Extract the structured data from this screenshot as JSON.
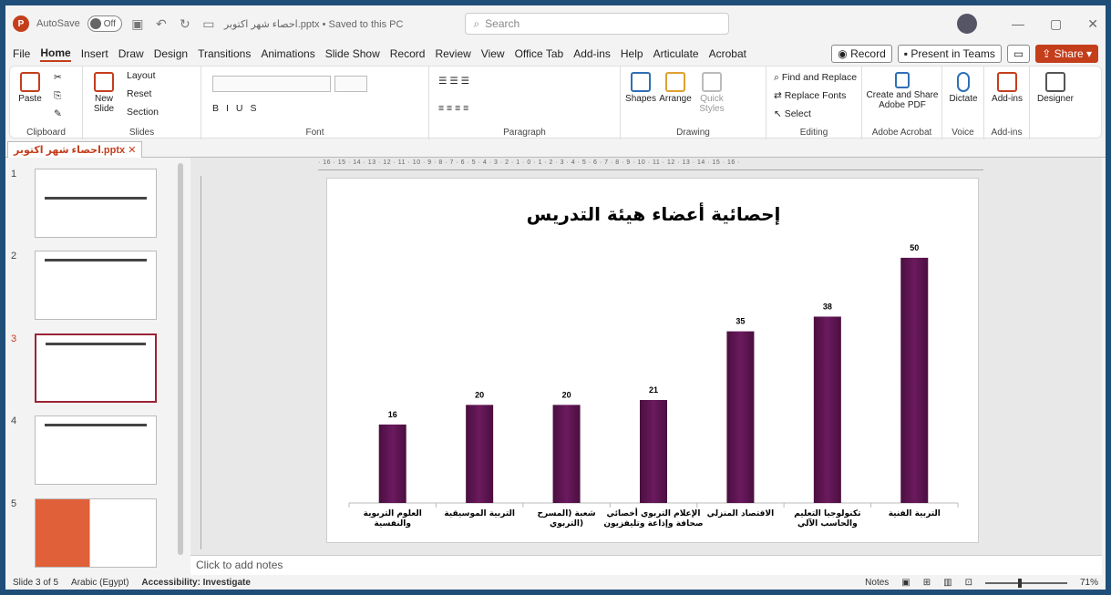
{
  "window": {
    "autosave_label": "AutoSave",
    "autosave_state": "Off",
    "doc_title": "احصاء شهر اكتوبر.pptx • Saved to this PC",
    "search_placeholder": "Search"
  },
  "menu": {
    "items": [
      "File",
      "Home",
      "Insert",
      "Draw",
      "Design",
      "Transitions",
      "Animations",
      "Slide Show",
      "Record",
      "Review",
      "View",
      "Office Tab",
      "Add-ins",
      "Help",
      "Articulate",
      "Acrobat"
    ],
    "record_btn": "Record",
    "present_btn": "Present in Teams",
    "share_btn": "Share"
  },
  "ribbon": {
    "clipboard": {
      "paste": "Paste",
      "label": "Clipboard"
    },
    "slides": {
      "new_slide": "New Slide",
      "layout": "Layout",
      "reset": "Reset",
      "section": "Section",
      "label": "Slides"
    },
    "font": {
      "label": "Font"
    },
    "paragraph": {
      "label": "Paragraph"
    },
    "drawing": {
      "shapes": "Shapes",
      "arrange": "Arrange",
      "quick_styles": "Quick Styles",
      "label": "Drawing"
    },
    "editing": {
      "find_replace": "Find and Replace",
      "replace_fonts": "Replace Fonts",
      "select": "Select",
      "label": "Editing"
    },
    "acrobat": {
      "create_share": "Create and Share Adobe PDF",
      "label": "Adobe Acrobat"
    },
    "voice": {
      "dictate": "Dictate",
      "label": "Voice"
    },
    "addins": {
      "addins": "Add-ins",
      "label": "Add-ins"
    },
    "designer": {
      "designer": "Designer"
    }
  },
  "tabs": {
    "doc_tab": "احصاء شهر اكتوبر.pptx"
  },
  "slides_panel": {
    "items": [
      {
        "num": "1"
      },
      {
        "num": "2"
      },
      {
        "num": "3"
      },
      {
        "num": "4"
      },
      {
        "num": "5"
      }
    ]
  },
  "ruler": {
    "h": "· 16 · 15 · 14 · 13 · 12 · 11 · 10 · 9 · 8 · 7 · 6 · 5 · 4 · 3 · 2 · 1 · 0 · 1 · 2 · 3 · 4 · 5 · 6 · 7 · 8 · 9 · 10 · 11 · 12 · 13 · 14 · 15 · 16 ·"
  },
  "notes": {
    "placeholder": "Click to add notes"
  },
  "status": {
    "slide": "Slide 3 of 5",
    "language": "Arabic (Egypt)",
    "accessibility": "Accessibility: Investigate",
    "notes_btn": "Notes",
    "zoom": "71%"
  },
  "chart_data": {
    "type": "bar",
    "title": "إحصائية أعضاء هيئة التدريس",
    "categories": [
      "العلوم التربوية والنفسية",
      "التربية الموسيقية",
      "شعبة (المسرح التربوي)",
      "الإعلام التربوي أخصائي صحافة وإذاعة وتليفزيون",
      "الاقتصاد المنزلي",
      "تكنولوجيا التعليم والحاسب الآلي",
      "التربية الفنية"
    ],
    "values": [
      16,
      20,
      20,
      21,
      35,
      38,
      50
    ],
    "ylim": [
      0,
      55
    ],
    "color": "#6b1a5e"
  }
}
